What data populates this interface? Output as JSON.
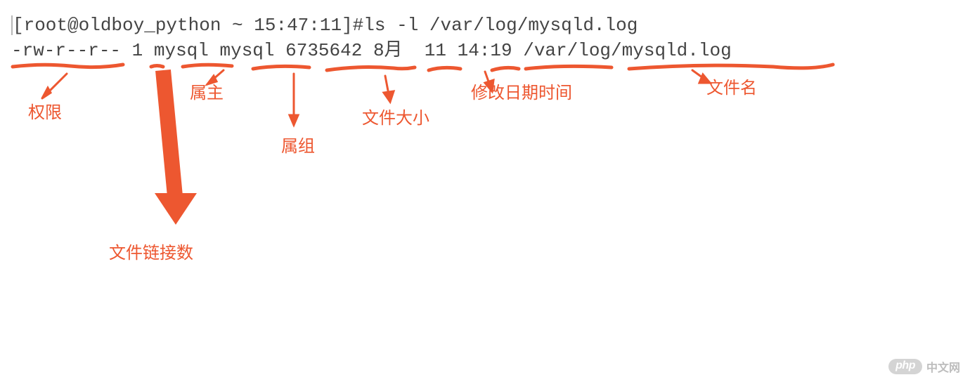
{
  "terminal": {
    "prompt": "[root@oldboy_python ~ 15:47:11]#",
    "command": "ls -l /var/log/mysqld.log",
    "output": {
      "permissions": "-rw-r--r--",
      "links": "1",
      "owner": "mysql",
      "group": "mysql",
      "size": "6735642",
      "month": "8月",
      "day": "11",
      "time": "14:19",
      "filename": "/var/log/mysqld.log"
    }
  },
  "labels": {
    "permissions": "权限",
    "links": "文件链接数",
    "owner": "属主",
    "group": "属组",
    "size": "文件大小",
    "datetime": "修改日期时间",
    "filename": "文件名"
  },
  "watermark": {
    "php": "php",
    "text": "中文网"
  },
  "colors": {
    "annotation": "#ed5730"
  }
}
